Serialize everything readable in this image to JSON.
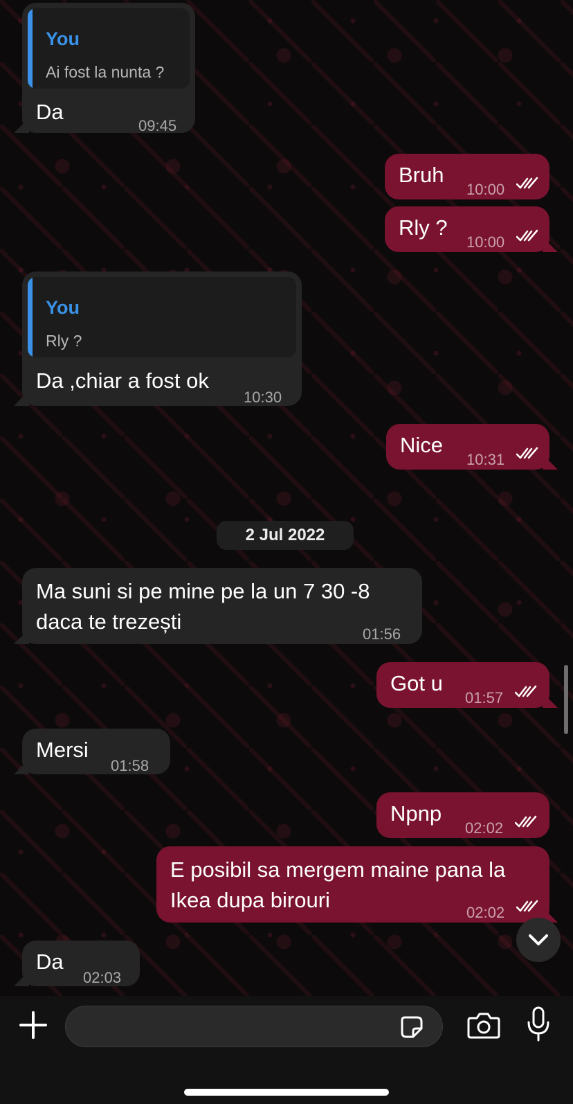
{
  "messages": [
    {
      "direction": "in",
      "reply": {
        "name": "You",
        "text": "Ai fost la nunta ?"
      },
      "text": "Da",
      "time": "09:45"
    },
    {
      "direction": "out",
      "text": "Bruh",
      "time": "10:00",
      "read": true
    },
    {
      "direction": "out",
      "text": "Rly ?",
      "time": "10:00",
      "read": true
    },
    {
      "direction": "in",
      "reply": {
        "name": "You",
        "text": "Rly ?"
      },
      "text": "Da ,chiar a fost ok",
      "time": "10:30"
    },
    {
      "direction": "out",
      "text": "Nice",
      "time": "10:31",
      "read": true
    },
    {
      "direction": "in",
      "text_lines": [
        "Ma suni si pe mine pe la un 7 30 -8",
        "daca te trezești"
      ],
      "time": "01:56"
    },
    {
      "direction": "out",
      "text": "Got u",
      "time": "01:57",
      "read": true
    },
    {
      "direction": "in",
      "text": "Mersi",
      "time": "01:58"
    },
    {
      "direction": "out",
      "text": "Npnp",
      "time": "02:02",
      "read": true
    },
    {
      "direction": "out",
      "text_lines": [
        "E posibil sa mergem maine pana la",
        "Ikea dupa birouri"
      ],
      "time": "02:02",
      "read": true
    },
    {
      "direction": "in",
      "text": "Da",
      "time": "02:03"
    }
  ],
  "date_separator": "2 Jul 2022",
  "composer": {
    "placeholder": "",
    "icons": [
      "plus-icon",
      "sticker-icon",
      "camera-icon",
      "microphone-icon"
    ]
  },
  "colors": {
    "incoming_bubble": "#252525",
    "outgoing_bubble": "#7a1330",
    "quote_accent": "#3a92e8",
    "background": "#0c0a0b"
  }
}
